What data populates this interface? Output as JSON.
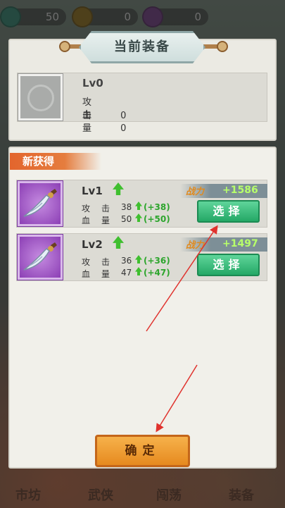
{
  "resources": [
    {
      "icon": "jade-gem-icon",
      "value": "50"
    },
    {
      "icon": "coin-icon",
      "value": "0"
    },
    {
      "icon": "purple-gem-icon",
      "value": "0"
    }
  ],
  "current_panel": {
    "title": "当前装备",
    "level": "Lv0",
    "attack_label": "攻击",
    "attack_value": "0",
    "hp_label": "血量",
    "hp_value": "0"
  },
  "new_panel": {
    "tag": "新获得",
    "items": [
      {
        "level": "Lv1",
        "attack_label": "攻击",
        "attack": "38",
        "attack_bonus": "(+38)",
        "hp_label": "血量",
        "hp": "50",
        "hp_bonus": "(+50)",
        "power_label": "战力",
        "power": "+1586",
        "select_label": "选择",
        "icon": "curved-blade-icon"
      },
      {
        "level": "Lv2",
        "attack_label": "攻击",
        "attack": "36",
        "attack_bonus": "(+36)",
        "hp_label": "血量",
        "hp": "47",
        "hp_bonus": "(+47)",
        "power_label": "战力",
        "power": "+1497",
        "select_label": "选择",
        "icon": "curved-blade-icon"
      }
    ]
  },
  "confirm_label": "确定",
  "bottom_nav": [
    "市坊",
    "武侠",
    "闯荡",
    "装备"
  ],
  "colors": {
    "panel": "#f1f0ea",
    "select_button": "#24a866",
    "confirm_button": "#e68a1f",
    "power_value": "#b7ff6a",
    "arrow": "#e0322d"
  }
}
